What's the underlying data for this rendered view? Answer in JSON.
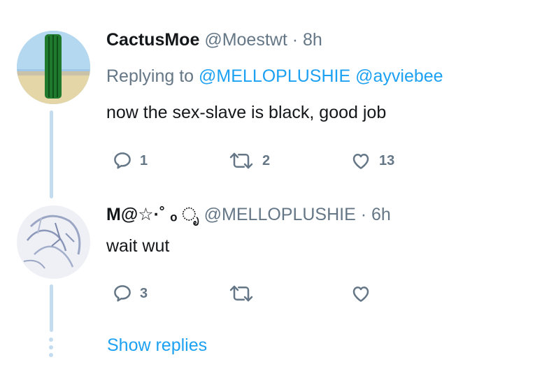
{
  "tweets": [
    {
      "display_name": "CactusMoe",
      "handle": "@Moestwt",
      "separator": "·",
      "time": "8h",
      "replying_prefix": "Replying to",
      "replying_mentions": [
        "@MELLOPLUSHIE",
        "@ayviebee"
      ],
      "text": "now the sex-slave is black, good job",
      "replies": "1",
      "retweets": "2",
      "likes": "13"
    },
    {
      "display_name": "M@☆·˚ ₒ ೃ",
      "handle": "@MELLOPLUSHIE",
      "separator": "·",
      "time": "6h",
      "text": "wait wut",
      "replies": "3",
      "retweets": "",
      "likes": ""
    }
  ],
  "show_replies_label": "Show replies",
  "icons": {
    "reply": "reply-icon",
    "retweet": "retweet-icon",
    "like": "heart-icon"
  },
  "colors": {
    "link": "#1da1f2",
    "muted": "#657786",
    "text": "#14171a",
    "thread_line": "#c4dcef"
  }
}
